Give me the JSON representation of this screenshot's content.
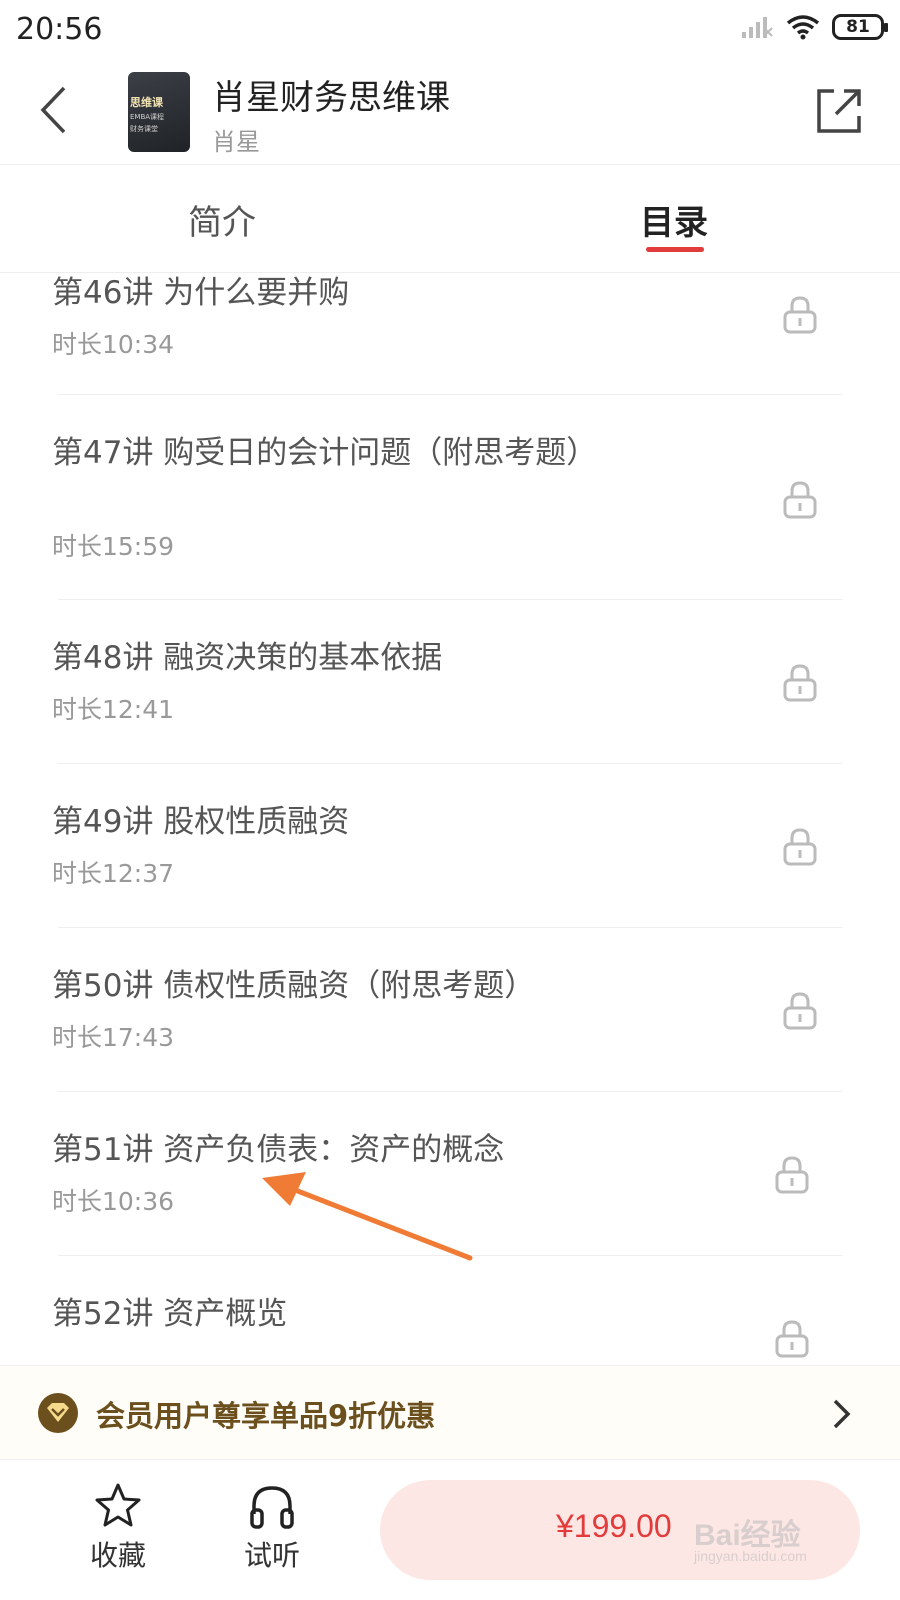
{
  "status_bar": {
    "time": "20:56",
    "battery": "81"
  },
  "header": {
    "cover_lines": [
      "思维课",
      "EMBA课程",
      "财务课堂"
    ],
    "title": "肖星财务思维课",
    "author": "肖星"
  },
  "tabs": [
    {
      "label": "简介",
      "active": false
    },
    {
      "label": "目录",
      "active": true
    }
  ],
  "lessons": [
    {
      "title": "第46讲 为什么要并购",
      "duration": "时长10:34",
      "locked": true
    },
    {
      "title": "第47讲 购受日的会计问题（附思考题）",
      "duration": "时长15:59",
      "locked": true
    },
    {
      "title": "第48讲 融资决策的基本依据",
      "duration": "时长12:41",
      "locked": true
    },
    {
      "title": "第49讲 股权性质融资",
      "duration": "时长12:37",
      "locked": true
    },
    {
      "title": "第50讲 债权性质融资（附思考题）",
      "duration": "时长17:43",
      "locked": true
    },
    {
      "title": "第51讲 资产负债表：资产的概念",
      "duration": "时长10:36",
      "locked": true
    },
    {
      "title": "第52讲 资产概览",
      "duration": "",
      "locked": true
    }
  ],
  "member_banner": {
    "text": "会员用户尊享单品9折优惠"
  },
  "bottom_bar": {
    "favorite_label": "收藏",
    "listen_label": "试听",
    "price": "¥199.00"
  },
  "watermark": {
    "main": "Bai经验",
    "sub": "jingyan.baidu.com"
  },
  "colors": {
    "accent": "#e23b3b",
    "member_gold": "#6b4f1d",
    "annotation_arrow": "#f07b35"
  }
}
